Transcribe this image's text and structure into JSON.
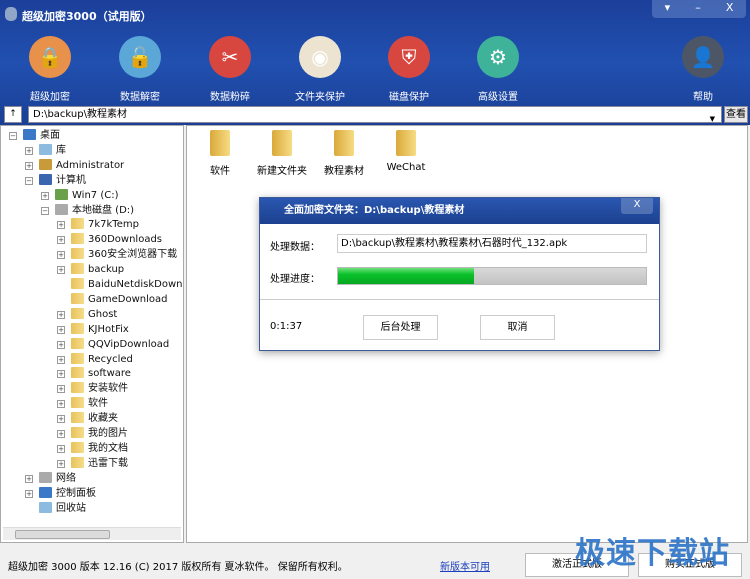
{
  "window": {
    "title": "超级加密3000（试用版）",
    "controls": [
      "▾",
      "–",
      "X"
    ]
  },
  "toolbar": [
    {
      "label": "超级加密",
      "icon": "lock-icon",
      "color": "#e8914a"
    },
    {
      "label": "数据解密",
      "icon": "unlock-icon",
      "color": "#5ba8d8"
    },
    {
      "label": "数据粉碎",
      "icon": "scissors-icon",
      "color": "#d8473f"
    },
    {
      "label": "文件夹保护",
      "icon": "color-wheel-icon",
      "color": "#ece4d0"
    },
    {
      "label": "磁盘保护",
      "icon": "shield-icon",
      "color": "#d8473f"
    },
    {
      "label": "高级设置",
      "icon": "gear-icon",
      "color": "#3fb39a"
    },
    {
      "label": "帮助",
      "icon": "user-icon",
      "color": "#4c5666"
    }
  ],
  "pathbar": {
    "up": "↑",
    "path": "D:\\backup\\教程素材",
    "view": "查看"
  },
  "tree": [
    {
      "label": "桌面",
      "level": 0,
      "exp": "-"
    },
    {
      "label": "库",
      "level": 1,
      "exp": "+"
    },
    {
      "label": "Administrator",
      "level": 1,
      "exp": "+"
    },
    {
      "label": "计算机",
      "level": 1,
      "exp": "-"
    },
    {
      "label": "Win7 (C:)",
      "level": 2,
      "exp": "+"
    },
    {
      "label": "本地磁盘 (D:)",
      "level": 2,
      "exp": "-"
    },
    {
      "label": "7k7kTemp",
      "level": 3,
      "exp": "+"
    },
    {
      "label": "360Downloads",
      "level": 3,
      "exp": "+"
    },
    {
      "label": "360安全浏览器下载",
      "level": 3,
      "exp": "+"
    },
    {
      "label": "backup",
      "level": 3,
      "exp": "+"
    },
    {
      "label": "BaiduNetdiskDownload",
      "level": 3,
      "exp": ""
    },
    {
      "label": "GameDownload",
      "level": 3,
      "exp": ""
    },
    {
      "label": "Ghost",
      "level": 3,
      "exp": "+"
    },
    {
      "label": "KJHotFix",
      "level": 3,
      "exp": "+"
    },
    {
      "label": "QQVipDownload",
      "level": 3,
      "exp": "+"
    },
    {
      "label": "Recycled",
      "level": 3,
      "exp": "+"
    },
    {
      "label": "software",
      "level": 3,
      "exp": "+"
    },
    {
      "label": "安装软件",
      "level": 3,
      "exp": "+"
    },
    {
      "label": "软件",
      "level": 3,
      "exp": "+"
    },
    {
      "label": "收藏夹",
      "level": 3,
      "exp": "+"
    },
    {
      "label": "我的图片",
      "level": 3,
      "exp": "+"
    },
    {
      "label": "我的文档",
      "level": 3,
      "exp": "+"
    },
    {
      "label": "迅雷下载",
      "level": 3,
      "exp": "+"
    },
    {
      "label": "网络",
      "level": 1,
      "exp": "+"
    },
    {
      "label": "控制面板",
      "level": 1,
      "exp": "+"
    },
    {
      "label": "回收站",
      "level": 1,
      "exp": ""
    }
  ],
  "files": [
    "软件",
    "新建文件夹",
    "教程素材",
    "WeChat"
  ],
  "dialog": {
    "title": "全面加密文件夹：D:\\backup\\教程素材",
    "close": "X",
    "data_label": "处理数据：",
    "data_value": "D:\\backup\\教程素材\\教程素材\\石器时代_132.apk",
    "progress_label": "处理进度：",
    "progress": 0.44,
    "elapsed": "0:1:37",
    "background_btn": "后台处理",
    "cancel_btn": "取消"
  },
  "status": {
    "text": "超级加密 3000  版本 12.16 (C) 2017 版权所有 夏冰软件。 保留所有权利。",
    "new_version": "新版本可用",
    "activate": "激活正式版",
    "buy": "购买正式版"
  },
  "watermark": "极速下载站"
}
